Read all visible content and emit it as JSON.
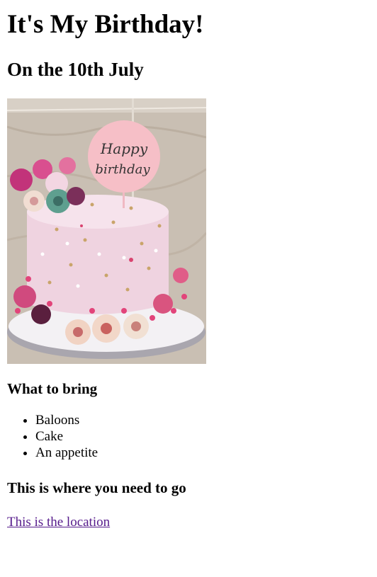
{
  "title": "It's My Birthday!",
  "subtitle": "On the 10th July",
  "photo": {
    "topper_line1": "Happy",
    "topper_line2": "birthday"
  },
  "bring": {
    "heading": "What to bring",
    "items": [
      "Baloons",
      "Cake",
      "An appetite"
    ]
  },
  "where": {
    "heading": "This is where you need to go",
    "link_text": "This is the location"
  },
  "colors": {
    "text": "#000000",
    "visited_link": "#551a8b",
    "background": "#ffffff"
  }
}
